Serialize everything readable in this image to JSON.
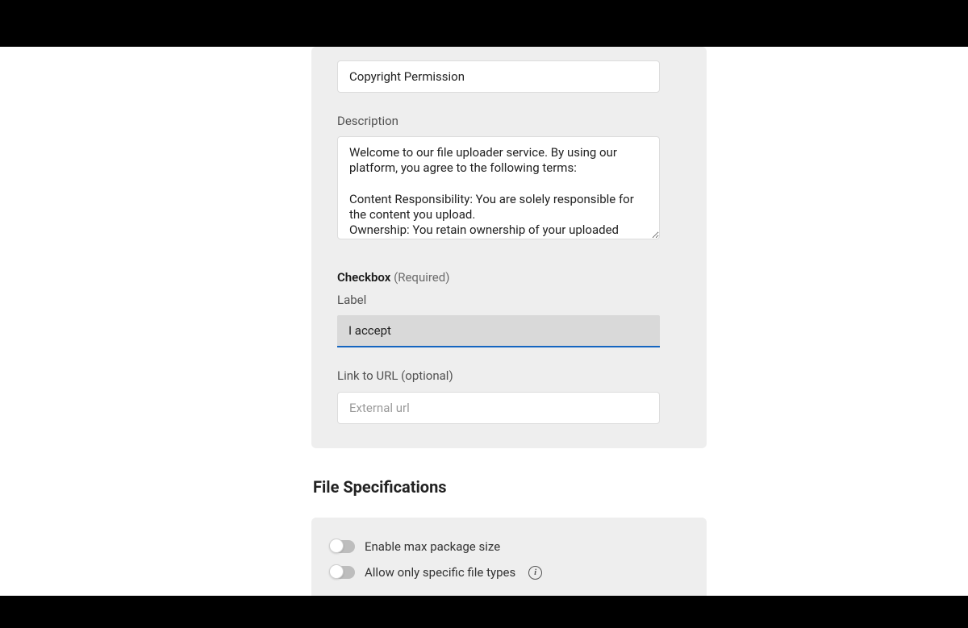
{
  "form": {
    "title_value": "Copyright Permission",
    "description_label": "Description",
    "description_value": "Welcome to our file uploader service. By using our platform, you agree to the following terms:\n\nContent Responsibility: You are solely responsible for the content you upload.\nOwnership: You retain ownership of your uploaded",
    "checkbox_heading": "Checkbox",
    "checkbox_required": "(Required)",
    "label_label": "Label",
    "label_value": "I accept",
    "link_label": "Link to URL (optional)",
    "link_placeholder": "External url"
  },
  "fileSpec": {
    "heading": "File Specifications",
    "toggles": [
      {
        "label": "Enable max package size",
        "info": false
      },
      {
        "label": "Allow only specific file types",
        "info": true
      }
    ]
  }
}
